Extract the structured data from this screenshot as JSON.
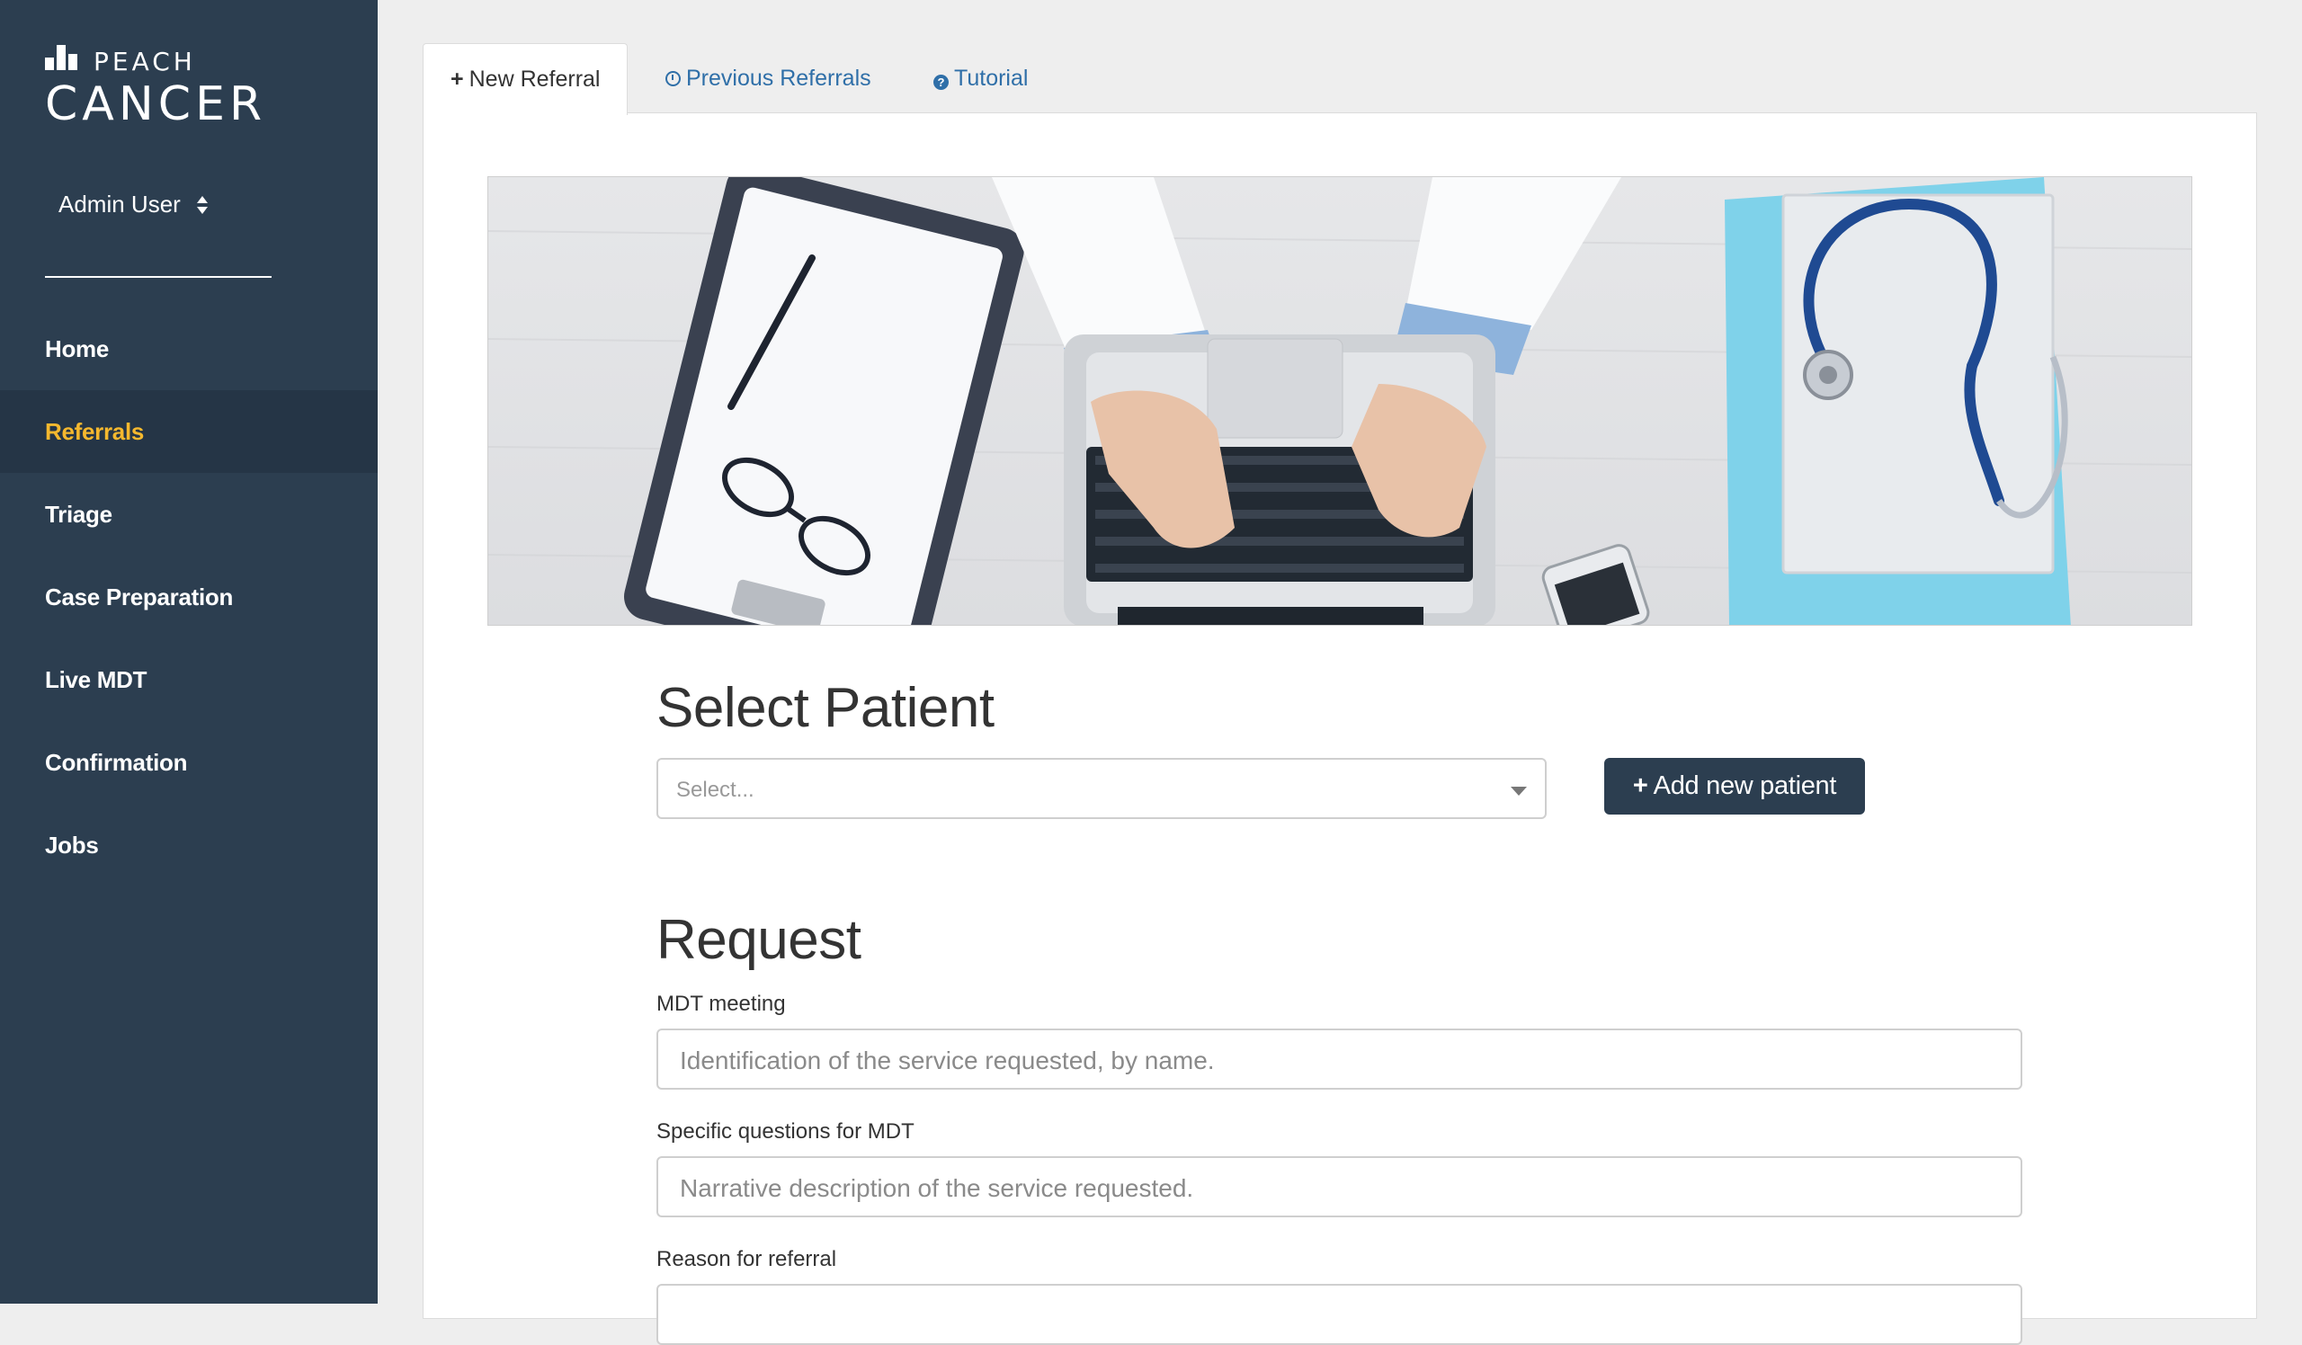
{
  "brand": {
    "top": "PEACH",
    "main": "CANCER"
  },
  "user": {
    "name": "Admin User"
  },
  "nav": {
    "items": [
      {
        "label": "Home"
      },
      {
        "label": "Referrals"
      },
      {
        "label": "Triage"
      },
      {
        "label": "Case Preparation"
      },
      {
        "label": "Live MDT"
      },
      {
        "label": "Confirmation"
      },
      {
        "label": "Jobs"
      }
    ],
    "active": "Referrals"
  },
  "tabs": [
    {
      "label": "New Referral",
      "icon": "plus-icon"
    },
    {
      "label": "Previous Referrals",
      "icon": "clock-icon"
    },
    {
      "label": "Tutorial",
      "icon": "question-circle-icon"
    }
  ],
  "hero": {
    "description": "doctor typing on laptop with clipboard, glasses and stethoscope"
  },
  "select_patient": {
    "title": "Select Patient",
    "placeholder": "Select...",
    "add_button": "Add new patient"
  },
  "request": {
    "title": "Request",
    "fields": [
      {
        "label": "MDT meeting",
        "placeholder": "Identification of the service requested, by name."
      },
      {
        "label": "Specific questions for MDT",
        "placeholder": "Narrative description of the service requested."
      },
      {
        "label": "Reason for referral",
        "placeholder": ""
      }
    ]
  },
  "colors": {
    "sidebar": "#2c3e50",
    "active_nav_bg": "#253546",
    "active_nav_text": "#f5b82e",
    "link": "#2f6fa8",
    "button": "#2c3e50"
  }
}
